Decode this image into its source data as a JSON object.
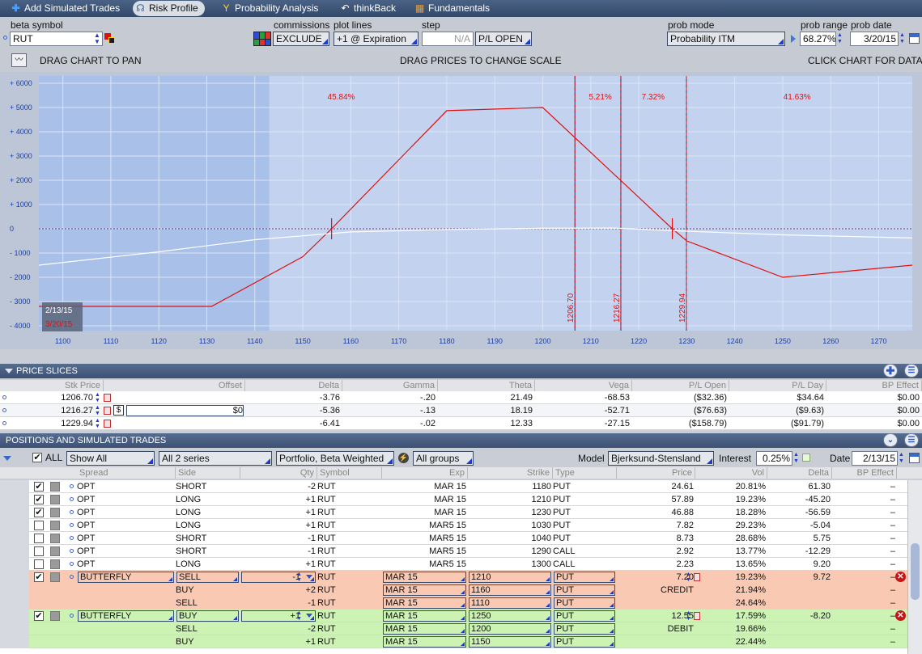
{
  "tabs": [
    {
      "label": "Add Simulated Trades",
      "icon": "plus-icon"
    },
    {
      "label": "Risk Profile",
      "icon": "risk-profile-icon"
    },
    {
      "label": "Probability Analysis",
      "icon": "probability-icon"
    },
    {
      "label": "thinkBack",
      "icon": "thinkback-icon"
    },
    {
      "label": "Fundamentals",
      "icon": "fundamentals-icon"
    }
  ],
  "controls": {
    "beta_symbol_label": "beta symbol",
    "beta_symbol_value": "RUT",
    "commissions_label": "commissions",
    "commissions_value": "EXCLUDE",
    "plot_lines_label": "plot lines",
    "plot_lines_value": "+1 @ Expiration",
    "step_label": "step",
    "step_value": "N/A",
    "pl_open": "P/L OPEN",
    "prob_mode_label": "prob mode",
    "prob_mode_value": "Probability ITM",
    "prob_range_label": "prob range",
    "prob_range_value": "68.27%",
    "prob_date_label": "prob date",
    "prob_date_value": "3/20/15",
    "drag_pan": "DRAG CHART TO PAN",
    "drag_prices": "DRAG PRICES TO CHANGE SCALE",
    "click_chart": "CLICK CHART FOR DATA"
  },
  "chart_data": {
    "type": "line",
    "x_ticks": [
      1100,
      1110,
      1120,
      1130,
      1140,
      1150,
      1160,
      1170,
      1180,
      1190,
      1200,
      1210,
      1220,
      1230,
      1240,
      1250,
      1260,
      1270
    ],
    "y_ticks": [
      "+ 6000",
      "+ 5000",
      "+ 4000",
      "+ 3000",
      "+ 2000",
      "+ 1000",
      "0",
      "- 1000",
      "- 2000",
      "- 3000",
      "- 4000"
    ],
    "y_values": [
      6000,
      5000,
      4000,
      3000,
      2000,
      1000,
      0,
      -1000,
      -2000,
      -3000,
      -4000
    ],
    "xlim": [
      1095,
      1277
    ],
    "ylim": [
      -4200,
      6300
    ],
    "series": [
      {
        "name": "3/20/15",
        "color": "#e01010",
        "points": [
          [
            1095,
            -3200
          ],
          [
            1131,
            -3200
          ],
          [
            1150,
            -1150
          ],
          [
            1156,
            0
          ],
          [
            1180,
            4870
          ],
          [
            1200,
            5000
          ],
          [
            1227,
            0
          ],
          [
            1230,
            -500
          ],
          [
            1250,
            -2000
          ],
          [
            1277,
            -1500
          ]
        ]
      },
      {
        "name": "2/13/15",
        "color": "#ffffff",
        "points": [
          [
            1095,
            -1500
          ],
          [
            1120,
            -950
          ],
          [
            1140,
            -450
          ],
          [
            1160,
            -130
          ],
          [
            1180,
            -30
          ],
          [
            1200,
            20
          ],
          [
            1215,
            30
          ],
          [
            1230,
            -100
          ],
          [
            1250,
            -250
          ],
          [
            1277,
            -380
          ]
        ]
      }
    ],
    "price_lines": [
      {
        "x": 1206.7,
        "label": "1206.70"
      },
      {
        "x": 1216.27,
        "label": "1216.27"
      },
      {
        "x": 1229.94,
        "label": "1229.94"
      }
    ],
    "prob_boundaries": [
      1206.7,
      1216.27,
      1229.94
    ],
    "prob_labels": [
      {
        "x": 1158,
        "text": "45.84%"
      },
      {
        "x": 1212,
        "text": "5.21%"
      },
      {
        "x": 1223,
        "text": "7.32%"
      },
      {
        "x": 1253,
        "text": "41.63%"
      }
    ],
    "range_markers": [
      1156,
      1227
    ],
    "legend": [
      "2/13/15",
      "3/20/15"
    ]
  },
  "price_slices": {
    "title": "PRICE SLICES",
    "headers": [
      "Stk Price",
      "Offset",
      "Delta",
      "Gamma",
      "Theta",
      "Vega",
      "P/L Open",
      "P/L Day",
      "BP Effect"
    ],
    "rows": [
      [
        "1206.70",
        "",
        "-3.76",
        "-.20",
        "21.49",
        "-68.53",
        "($32.36)",
        "$34.64",
        "$0.00"
      ],
      [
        "1216.27",
        "$0",
        "-5.36",
        "-.13",
        "18.19",
        "-52.71",
        "($76.63)",
        "($9.63)",
        "$0.00"
      ],
      [
        "1229.94",
        "",
        "-6.41",
        "-.02",
        "12.33",
        "-27.15",
        "($158.79)",
        "($91.79)",
        "$0.00"
      ]
    ]
  },
  "positions": {
    "title": "POSITIONS AND SIMULATED TRADES",
    "all_label": "ALL",
    "show_all": "Show All",
    "series": "All 2 series",
    "portfolio": "Portfolio, Beta Weighted",
    "groups": "All groups",
    "model_label": "Model",
    "model_value": "Bjerksund-Stensland",
    "interest_label": "Interest",
    "interest_value": "0.25%",
    "date_label": "Date",
    "date_value": "2/13/15",
    "headers": [
      "Spread",
      "Side",
      "Qty",
      "Symbol",
      "Exp",
      "Strike",
      "Type",
      "Price",
      "Vol",
      "Delta",
      "BP Effect"
    ],
    "rows": [
      {
        "checked": true,
        "spread": "OPT",
        "side": "SHORT",
        "qty": "-2",
        "symbol": "RUT",
        "exp": "MAR 15",
        "strike": "1180",
        "type": "PUT",
        "price": "24.61",
        "vol": "20.81%",
        "delta": "61.30",
        "bp": "–"
      },
      {
        "checked": true,
        "spread": "OPT",
        "side": "LONG",
        "qty": "+1",
        "symbol": "RUT",
        "exp": "MAR 15",
        "strike": "1210",
        "type": "PUT",
        "price": "57.89",
        "vol": "19.23%",
        "delta": "-45.20",
        "bp": "–"
      },
      {
        "checked": true,
        "spread": "OPT",
        "side": "LONG",
        "qty": "+1",
        "symbol": "RUT",
        "exp": "MAR 15",
        "strike": "1230",
        "type": "PUT",
        "price": "46.88",
        "vol": "18.28%",
        "delta": "-56.59",
        "bp": "–"
      },
      {
        "checked": false,
        "spread": "OPT",
        "side": "LONG",
        "qty": "+1",
        "symbol": "RUT",
        "exp": "MAR5 15",
        "strike": "1030",
        "type": "PUT",
        "price": "7.82",
        "vol": "29.23%",
        "delta": "-5.04",
        "bp": "–"
      },
      {
        "checked": false,
        "spread": "OPT",
        "side": "SHORT",
        "qty": "-1",
        "symbol": "RUT",
        "exp": "MAR5 15",
        "strike": "1040",
        "type": "PUT",
        "price": "8.73",
        "vol": "28.68%",
        "delta": "5.75",
        "bp": "–"
      },
      {
        "checked": false,
        "spread": "OPT",
        "side": "SHORT",
        "qty": "-1",
        "symbol": "RUT",
        "exp": "MAR5 15",
        "strike": "1290",
        "type": "CALL",
        "price": "2.92",
        "vol": "13.77%",
        "delta": "-12.29",
        "bp": "–"
      },
      {
        "checked": false,
        "spread": "OPT",
        "side": "LONG",
        "qty": "+1",
        "symbol": "RUT",
        "exp": "MAR5 15",
        "strike": "1300",
        "type": "CALL",
        "price": "2.23",
        "vol": "13.65%",
        "delta": "9.20",
        "bp": "–"
      }
    ],
    "sim": [
      {
        "color": "#f9c9b4",
        "legs": [
          {
            "checked": true,
            "spread": "BUTTERFLY",
            "side": "SELL",
            "qty": "-1",
            "symbol": "RUT",
            "exp": "MAR 15",
            "strike": "1210",
            "type": "PUT",
            "price": "7.20",
            "vol": "19.23%",
            "delta": "9.72",
            "bp": "–"
          },
          {
            "side": "BUY",
            "qty": "+2",
            "symbol": "RUT",
            "exp": "MAR 15",
            "strike": "1160",
            "type": "PUT",
            "price": "CREDIT",
            "vol": "21.94%",
            "bp": "–"
          },
          {
            "side": "SELL",
            "qty": "-1",
            "symbol": "RUT",
            "exp": "MAR 15",
            "strike": "1110",
            "type": "PUT",
            "price": "",
            "vol": "24.64%",
            "bp": "–"
          }
        ]
      },
      {
        "color": "#ccf2b4",
        "legs": [
          {
            "checked": true,
            "spread": "BUTTERFLY",
            "side": "BUY",
            "qty": "+1",
            "symbol": "RUT",
            "exp": "MAR 15",
            "strike": "1250",
            "type": "PUT",
            "price": "12.55",
            "vol": "17.59%",
            "delta": "-8.20",
            "bp": "–"
          },
          {
            "side": "SELL",
            "qty": "-2",
            "symbol": "RUT",
            "exp": "MAR 15",
            "strike": "1200",
            "type": "PUT",
            "price": "DEBIT",
            "vol": "19.66%",
            "bp": "–"
          },
          {
            "side": "BUY",
            "qty": "+1",
            "symbol": "RUT",
            "exp": "MAR 15",
            "strike": "1150",
            "type": "PUT",
            "price": "",
            "vol": "22.44%",
            "bp": "–"
          }
        ]
      }
    ]
  }
}
